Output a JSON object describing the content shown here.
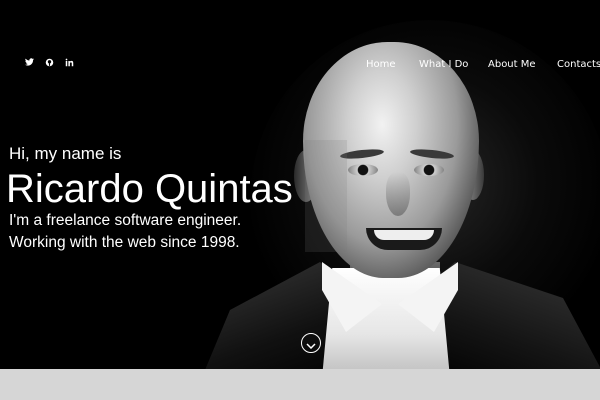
{
  "social": {
    "icons": [
      {
        "name": "twitter-icon",
        "glyph": "🐦"
      },
      {
        "name": "github-icon",
        "glyph": "⌾"
      },
      {
        "name": "linkedin-icon",
        "glyph": "in"
      }
    ]
  },
  "nav": {
    "items": [
      {
        "label": "Home"
      },
      {
        "label": "What I Do"
      },
      {
        "label": "About Me"
      },
      {
        "label": "Contacts"
      }
    ]
  },
  "hero": {
    "greeting": "Hi, my name is",
    "name": "Ricardo Quintas",
    "tagline_1": "I'm a freelance software engineer.",
    "tagline_2": "Working with the web since 1998."
  },
  "colors": {
    "background": "#000000",
    "text": "#ffffff",
    "frame": "#d6d6d6"
  },
  "scroll": {
    "icon": "chevron-down-icon"
  }
}
